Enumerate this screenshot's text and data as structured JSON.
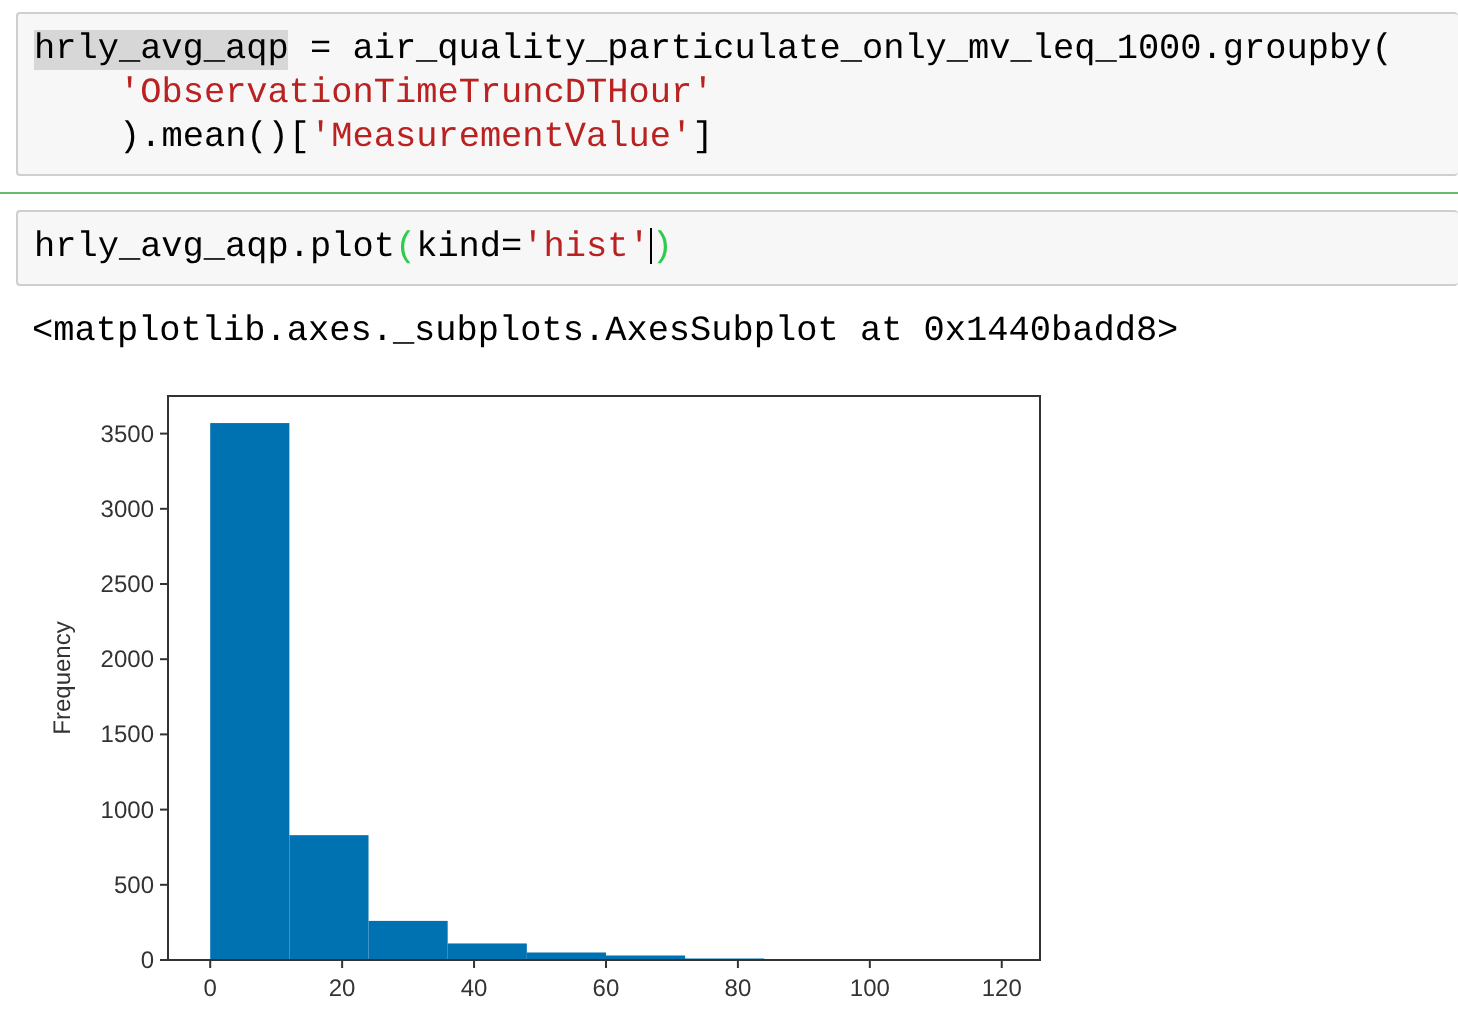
{
  "cells": [
    {
      "selected": false,
      "lines": [
        {
          "indent": false,
          "tokens": [
            {
              "text": "hrly_avg_aqp",
              "kind": "highlight"
            },
            {
              "text": " = air_quality_particulate_only_mv_leq_1000.groupby(",
              "kind": "plain"
            }
          ]
        },
        {
          "indent": true,
          "tokens": [
            {
              "text": "'ObservationTimeTruncDTHour'",
              "kind": "string"
            }
          ]
        },
        {
          "indent": true,
          "tokens": [
            {
              "text": ").mean()[",
              "kind": "plain"
            },
            {
              "text": "'MeasurementValue'",
              "kind": "string"
            },
            {
              "text": "]",
              "kind": "plain"
            }
          ]
        }
      ]
    },
    {
      "selected": true,
      "lines": [
        {
          "indent": false,
          "tokens": [
            {
              "text": "hrly_avg_aqp.plot",
              "kind": "plain"
            },
            {
              "text": "(",
              "kind": "bracket_match"
            },
            {
              "text": "kind=",
              "kind": "plain"
            },
            {
              "text": "'hist'",
              "kind": "string",
              "cursor_after": true
            },
            {
              "text": ")",
              "kind": "bracket_match"
            }
          ]
        }
      ],
      "output": "<matplotlib.axes._subplots.AxesSubplot at 0x1440badd8>",
      "chart_data": {
        "type": "bar",
        "ylabel": "Frequency",
        "x": [
          6,
          18,
          30,
          42,
          54,
          66,
          78
        ],
        "values": [
          3570,
          830,
          260,
          110,
          50,
          30,
          10
        ],
        "xlim": [
          -6.4,
          125.8
        ],
        "ylim": [
          0,
          3750
        ],
        "xticks": [
          0,
          20,
          40,
          60,
          80,
          100,
          120
        ],
        "yticks": [
          0,
          500,
          1000,
          1500,
          2000,
          2500,
          3000,
          3500
        ]
      }
    }
  ]
}
